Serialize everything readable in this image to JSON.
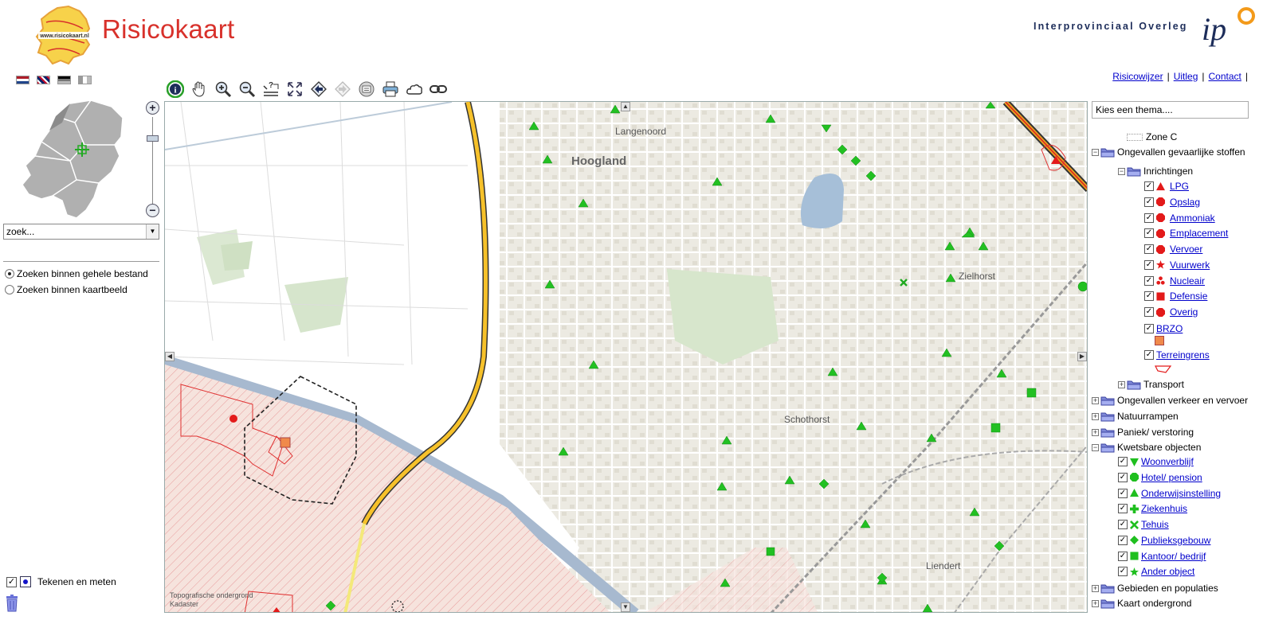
{
  "header": {
    "title": "Risicokaart",
    "logo_text": "www.risicokaart.nl",
    "ipo_name": "Interprovinciaal Overleg",
    "ipo_logo_text": "ip"
  },
  "links": [
    "Risicowijzer",
    "Uitleg",
    "Contact"
  ],
  "link_separator": "|",
  "languages": [
    "nl",
    "en",
    "de",
    "fr"
  ],
  "search": {
    "placeholder": "zoek..."
  },
  "search_options": [
    {
      "label": "Zoeken binnen gehele bestand",
      "selected": true
    },
    {
      "label": "Zoeken binnen kaartbeeld",
      "selected": false
    }
  ],
  "draw": {
    "label": "Tekenen en meten",
    "checked": true
  },
  "zoom": {
    "plus": "+",
    "minus": "−",
    "level": 0.22
  },
  "toolbar": [
    {
      "id": "info",
      "icon": "info-icon"
    },
    {
      "id": "pan",
      "icon": "hand-icon"
    },
    {
      "id": "zoom-in",
      "icon": "zoom-in-icon"
    },
    {
      "id": "zoom-out",
      "icon": "zoom-out-icon"
    },
    {
      "id": "query",
      "icon": "query-icon"
    },
    {
      "id": "full-extent",
      "icon": "full-extent-icon"
    },
    {
      "id": "back",
      "icon": "back-icon"
    },
    {
      "id": "forward",
      "icon": "forward-icon"
    },
    {
      "id": "legend",
      "icon": "legend-icon"
    },
    {
      "id": "print",
      "icon": "print-icon"
    },
    {
      "id": "cloud",
      "icon": "cloud-icon"
    },
    {
      "id": "link",
      "icon": "link-icon"
    }
  ],
  "map": {
    "labels": [
      "Langenoord",
      "Hoogland",
      "Zielhorst",
      "Schothorst",
      "Liendert"
    ],
    "copyright": [
      "Topografische ondergrond",
      "Kadaster"
    ]
  },
  "theme_select": {
    "placeholder": "Kies een thema...."
  },
  "layers": {
    "zone_c": "Zone C",
    "groups": [
      {
        "label": "Ongevallen gevaarlijke stoffen",
        "expanded": true
      },
      {
        "label": "Inrichtingen",
        "expanded": true
      },
      {
        "label": "Transport",
        "expanded": false
      },
      {
        "label": "Ongevallen verkeer en vervoer",
        "expanded": false
      },
      {
        "label": "Natuurrampen",
        "expanded": false
      },
      {
        "label": "Paniek/ verstoring",
        "expanded": false
      },
      {
        "label": "Kwetsbare objecten",
        "expanded": true
      },
      {
        "label": "Gebieden en populaties",
        "expanded": false
      },
      {
        "label": "Kaart ondergrond",
        "expanded": false
      }
    ],
    "inrichtingen": [
      {
        "label": "LPG",
        "symbol": "triangle",
        "color": "#e31a1a"
      },
      {
        "label": "Opslag",
        "symbol": "octagon",
        "color": "#e31a1a"
      },
      {
        "label": "Ammoniak",
        "symbol": "octagon",
        "color": "#e31a1a"
      },
      {
        "label": "Emplacement",
        "symbol": "octagon",
        "color": "#e31a1a"
      },
      {
        "label": "Vervoer",
        "symbol": "octagon",
        "color": "#e31a1a"
      },
      {
        "label": "Vuurwerk",
        "symbol": "star",
        "color": "#e31a1a"
      },
      {
        "label": "Nucleair",
        "symbol": "trefoil",
        "color": "#e31a1a"
      },
      {
        "label": "Defensie",
        "symbol": "square",
        "color": "#e31a1a"
      },
      {
        "label": "Overig",
        "symbol": "octagon",
        "color": "#e31a1a"
      }
    ],
    "brzo": {
      "label": "BRZO",
      "color": "#f08a4b"
    },
    "terreingrens": {
      "label": "Terreingrens",
      "color": "#e31a1a"
    },
    "kwetsbare": [
      {
        "label": "Woonverblijf",
        "symbol": "triangle-down",
        "color": "#1fbf1f"
      },
      {
        "label": "Hotel/ pension",
        "symbol": "octagon",
        "color": "#1fbf1f"
      },
      {
        "label": "Onderwijsinstelling",
        "symbol": "triangle",
        "color": "#1fbf1f"
      },
      {
        "label": "Ziekenhuis",
        "symbol": "cross",
        "color": "#1fbf1f"
      },
      {
        "label": "Tehuis",
        "symbol": "x",
        "color": "#1fbf1f"
      },
      {
        "label": "Publieksgebouw",
        "symbol": "diamond",
        "color": "#1fbf1f"
      },
      {
        "label": "Kantoor/ bedrijf",
        "symbol": "square",
        "color": "#1fbf1f"
      },
      {
        "label": "Ander object",
        "symbol": "star",
        "color": "#1fbf1f"
      }
    ]
  }
}
